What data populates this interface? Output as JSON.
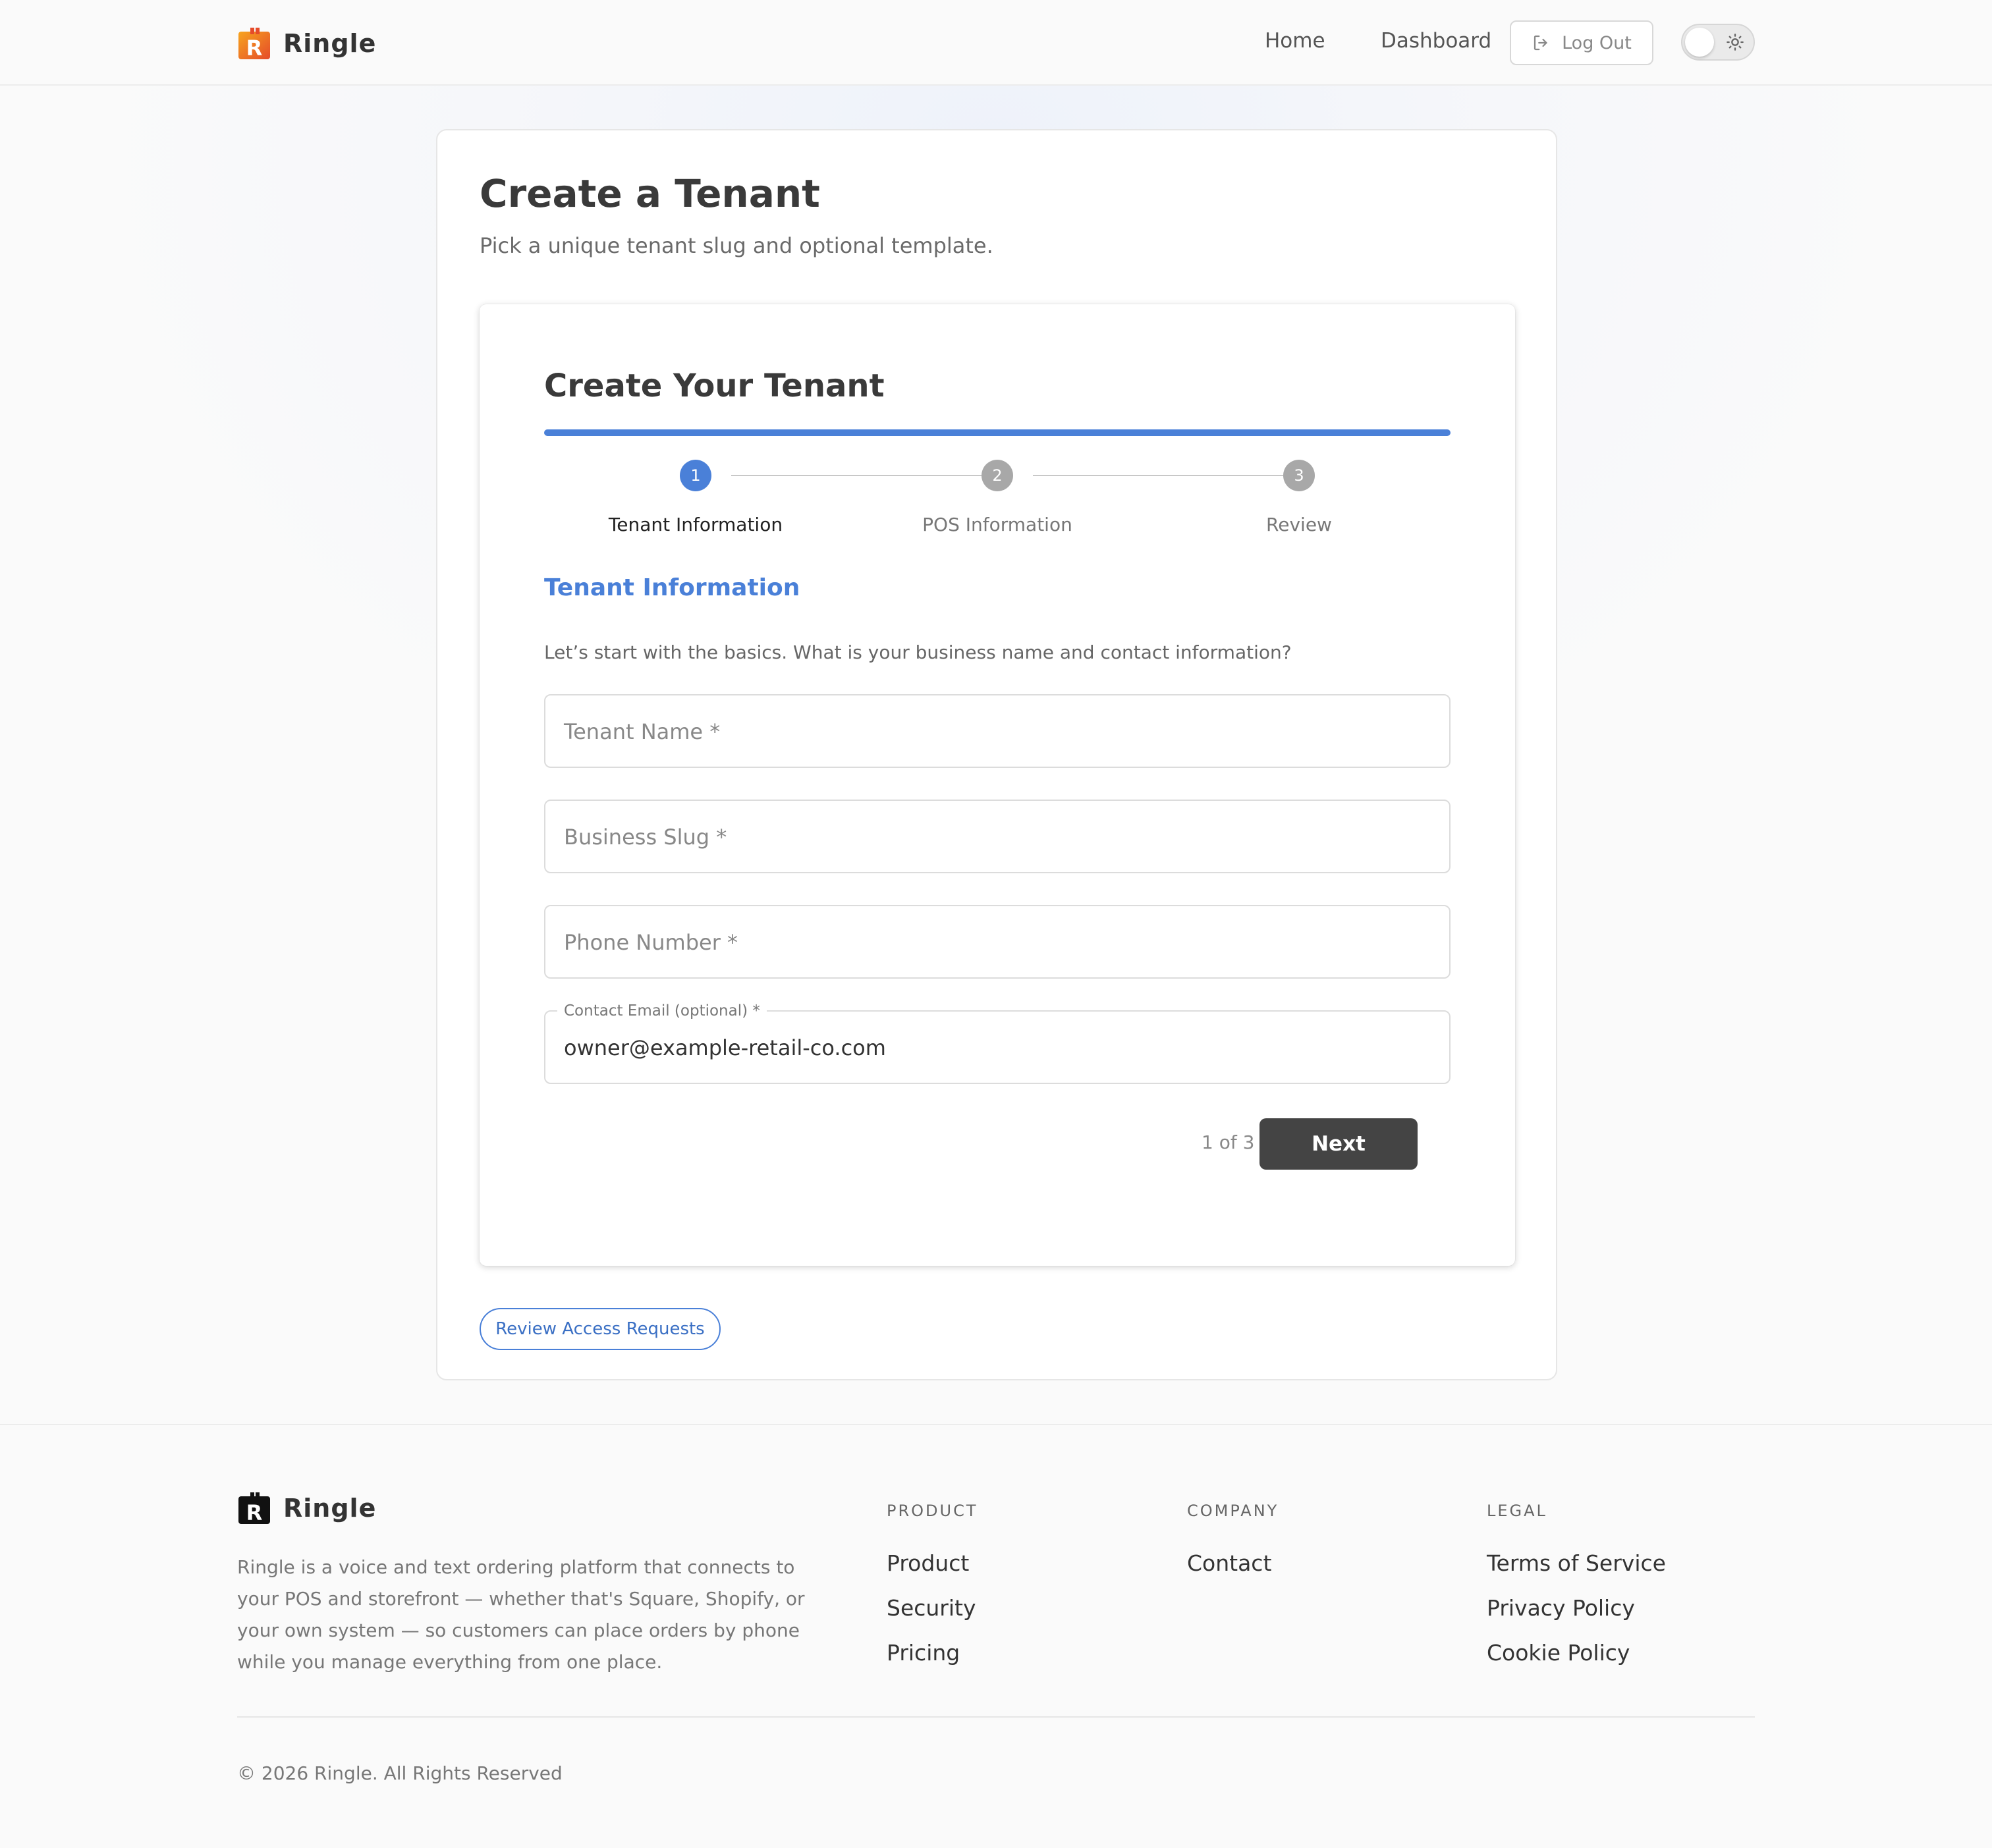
{
  "header": {
    "brand": "Ringle",
    "nav": {
      "home": "Home",
      "dashboard": "Dashboard"
    },
    "logout_label": "Log Out"
  },
  "main": {
    "title": "Create a Tenant",
    "subtitle": "Pick a unique tenant slug and optional template.",
    "wizard": {
      "title": "Create Your Tenant",
      "steps": [
        {
          "number": "1",
          "label": "Tenant Information"
        },
        {
          "number": "2",
          "label": "POS Information"
        },
        {
          "number": "3",
          "label": "Review"
        }
      ],
      "section_title": "Tenant Information",
      "section_desc": "Let’s start with the basics. What is your business name and contact information?",
      "fields": {
        "tenant_name": {
          "placeholder": "Tenant Name *"
        },
        "business_slug": {
          "placeholder": "Business Slug *"
        },
        "phone_number": {
          "placeholder": "Phone Number *"
        },
        "contact_email": {
          "label": "Contact Email (optional) *",
          "value": "owner@example-retail-co.com"
        }
      },
      "page_count": "1 of 3",
      "next_label": "Next"
    },
    "review_requests_label": "Review Access Requests"
  },
  "footer": {
    "brand": "Ringle",
    "description": "Ringle is a voice and text ordering platform that connects to your POS and storefront — whether that's Square, Shopify, or your own system — so customers can place orders by phone while you manage everything from one place.",
    "columns": [
      {
        "title": "PRODUCT",
        "links": [
          "Product",
          "Security",
          "Pricing"
        ]
      },
      {
        "title": "COMPANY",
        "links": [
          "Contact"
        ]
      },
      {
        "title": "LEGAL",
        "links": [
          "Terms of Service",
          "Privacy Policy",
          "Cookie Policy"
        ]
      }
    ],
    "copyright": "© 2026 Ringle. All Rights Reserved"
  },
  "colors": {
    "accent": "#4a80d8",
    "step_inactive": "#a8a8a8",
    "next_button": "#444444",
    "logo_orange": "#f08a1c",
    "logo_red": "#e54b2a"
  },
  "icons": [
    "ringle-logo-icon",
    "logout-icon",
    "sun-icon"
  ]
}
